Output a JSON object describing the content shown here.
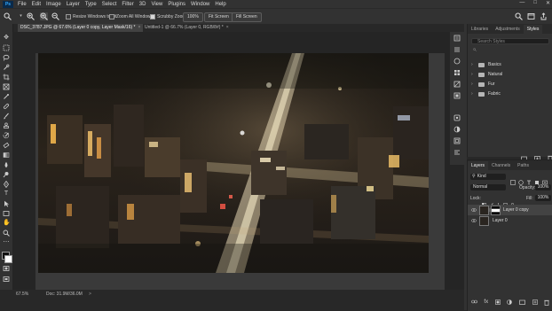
{
  "menu": {
    "logo": "Ps",
    "items": [
      "File",
      "Edit",
      "Image",
      "Layer",
      "Type",
      "Select",
      "Filter",
      "3D",
      "View",
      "Plugins",
      "Window",
      "Help"
    ],
    "window_controls": [
      "—",
      "□",
      "✕"
    ]
  },
  "options": {
    "zoom_in_icon": "zoom-in-icon",
    "zoom_out_icon": "zoom-out-icon",
    "resize_windows": "Resize Windows to Fit",
    "zoom_all": "Zoom All Windows",
    "scrubby": "Scrubby Zoom",
    "percent_btn": "100%",
    "fit_btn": "Fit Screen",
    "fill_btn": "Fill Screen"
  },
  "tabs": [
    {
      "label": "DSC_3787.JPG @ 67.6% (Layer 0 copy, Layer Mask/16) *",
      "close": "×"
    },
    {
      "label": "Untitled-1 @ 66.7% (Layer 0, RGB/8#) *",
      "close": "×"
    }
  ],
  "status": {
    "zoom": "67.5%",
    "doc": "Doc: 31.9M/36.0M",
    "arrow": ">"
  },
  "library_panel": {
    "tabs": [
      "Libraries",
      "Adjustments",
      "Styles"
    ],
    "search_placeholder": "Search Styles",
    "folders": [
      "Basics",
      "Natural",
      "Fur",
      "Fabric"
    ]
  },
  "layers_panel": {
    "tabs": [
      "Layers",
      "Channels",
      "Paths"
    ],
    "kind": "Kind",
    "blend_mode": "Normal",
    "opacity_label": "Opacity:",
    "opacity": "100%",
    "lock_label": "Lock:",
    "fill_label": "Fill:",
    "fill": "100%",
    "layers": [
      {
        "name": "Layer 0 copy",
        "selected": true
      },
      {
        "name": "Layer 0",
        "selected": false
      }
    ]
  }
}
